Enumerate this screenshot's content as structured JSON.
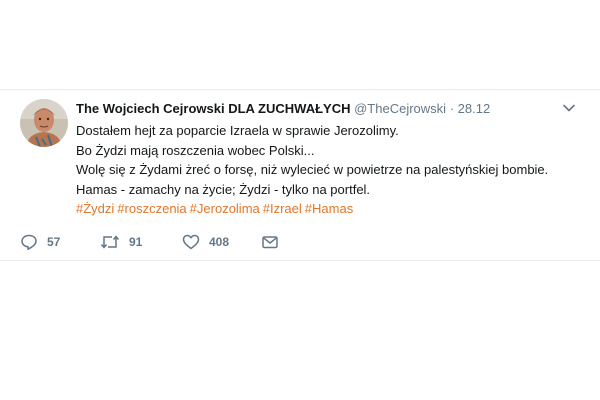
{
  "tweet": {
    "display_name": "The Wojciech Cejrowski DLA ZUCHWAŁYCH",
    "handle": "@TheCejrowski",
    "separator": "·",
    "date": "28.12",
    "lines": [
      "Dostałem hejt za poparcie Izraela w sprawie Jerozolimy.",
      "Bo Żydzi mają roszczenia wobec Polski...",
      "Wolę się z Żydami żreć o forsę, niż wylecieć w powietrze na palestyńskiej bombie.",
      "Hamas - zamachy na życie; Żydzi - tylko na portfel."
    ],
    "hashtags": [
      "#Żydzi",
      "#roszczenia",
      "#Jerozolima",
      "#Izrael",
      "#Hamas"
    ],
    "hashtag_color": "#e0772b"
  },
  "actions": {
    "reply_count": "57",
    "retweet_count": "91",
    "like_count": "408"
  },
  "icons": {
    "avatar": "user-avatar",
    "caret": "chevron-down-icon",
    "reply": "reply-icon",
    "retweet": "retweet-icon",
    "like": "heart-icon",
    "dm": "envelope-icon"
  }
}
